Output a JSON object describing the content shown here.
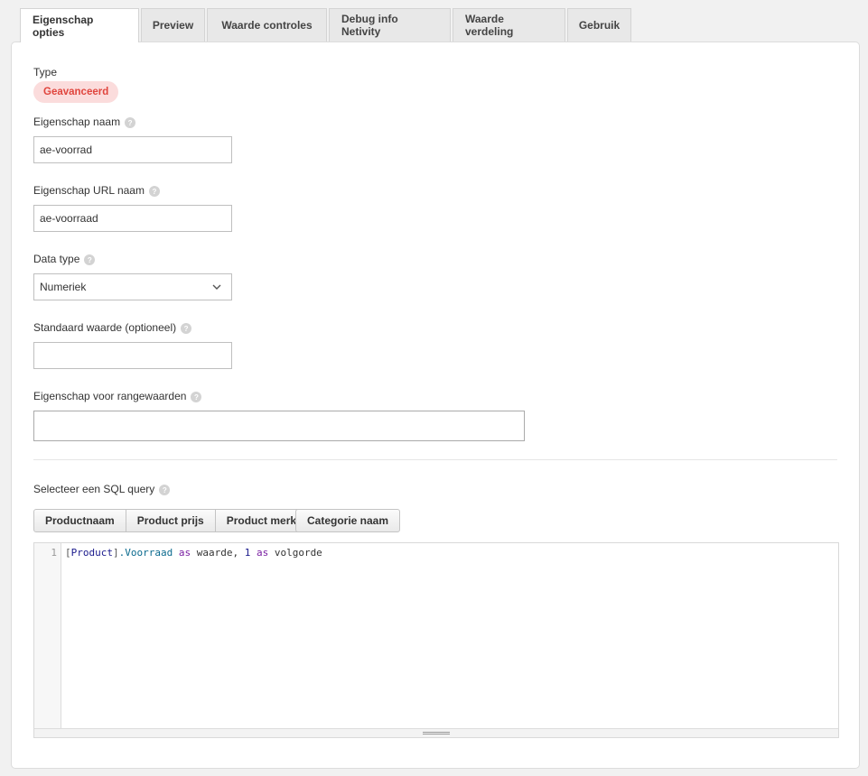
{
  "tabs": [
    {
      "label": "Eigenschap opties"
    },
    {
      "label": "Preview"
    },
    {
      "label": "Waarde controles"
    },
    {
      "label": "Debug info Netivity"
    },
    {
      "label": "Waarde verdeling"
    },
    {
      "label": "Gebruik"
    }
  ],
  "form": {
    "type_label": "Type",
    "type_badge": "Geavanceerd",
    "name_label": "Eigenschap naam",
    "name_value": "ae-voorrad",
    "url_label": "Eigenschap URL naam",
    "url_value": "ae-voorraad",
    "datatype_label": "Data type",
    "datatype_value": "Numeriek",
    "default_label": "Standaard waarde (optioneel)",
    "default_value": "",
    "range_label": "Eigenschap voor rangewaarden",
    "range_value": ""
  },
  "sql": {
    "label": "Selecteer een SQL query",
    "buttons": [
      "Productnaam",
      "Product prijs",
      "Product merk"
    ],
    "extra_button": "Categorie naam",
    "line_number": "1",
    "code": {
      "open": "[",
      "ident": "Product",
      "close": "]",
      "prop": ".Voorraad",
      "kw1": "as",
      "alias1": "waarde,",
      "num": "1",
      "kw2": "as",
      "alias2": "volgorde"
    }
  },
  "help_glyph": "?",
  "colors": {
    "badge_bg": "#fbdcdc",
    "badge_text": "#e0453d"
  }
}
